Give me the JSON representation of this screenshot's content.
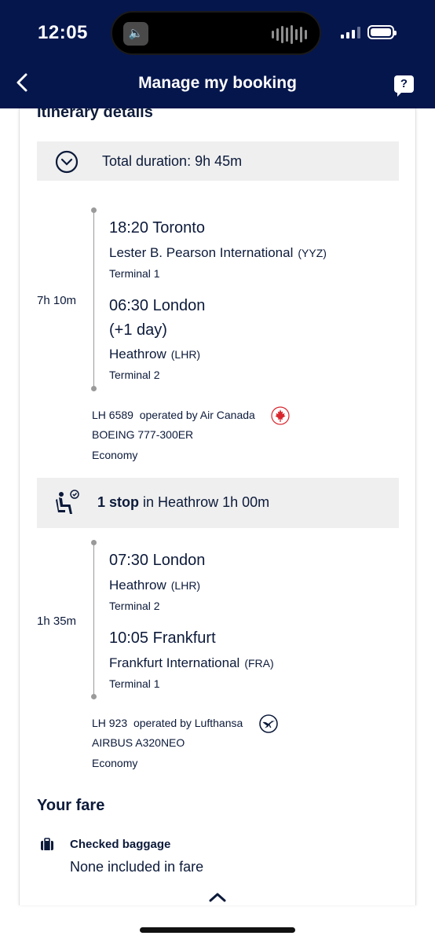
{
  "status_bar": {
    "time": "12:05"
  },
  "nav": {
    "title": "Manage my booking",
    "help_label": "?"
  },
  "itinerary": {
    "title": "Itinerary details",
    "total_duration": "Total duration: 9h 45m",
    "segments": [
      {
        "duration": "7h 10m",
        "departure": {
          "time_city": "18:20 Toronto",
          "airport": "Lester B. Pearson International",
          "code": "(YYZ)",
          "terminal": "Terminal 1"
        },
        "arrival": {
          "time_city": "06:30 London",
          "day_offset": "(+1 day)",
          "airport": "Heathrow",
          "code": "(LHR)",
          "terminal": "Terminal 2"
        },
        "flight": "LH 6589",
        "operated_by": "operated by Air Canada",
        "aircraft": "BOEING 777-300ER",
        "cabin": "Economy",
        "logo_icon": "air-canada-maple-leaf"
      },
      {
        "duration": "1h 35m",
        "departure": {
          "time_city": "07:30 London",
          "airport": "Heathrow",
          "code": "(LHR)",
          "terminal": "Terminal 2"
        },
        "arrival": {
          "time_city": "10:05 Frankfurt",
          "airport": "Frankfurt International",
          "code": "(FRA)",
          "terminal": "Terminal 1"
        },
        "flight": "LH 923",
        "operated_by": "operated by Lufthansa",
        "aircraft": "AIRBUS A320NEO",
        "cabin": "Economy",
        "logo_icon": "lufthansa-crane"
      }
    ],
    "stop": {
      "count": "1 stop",
      "detail": "in Heathrow 1h 00m"
    }
  },
  "fare": {
    "title": "Your fare",
    "items": [
      {
        "label": "Checked baggage",
        "value": "None included in fare",
        "icon": "baggage-icon"
      }
    ]
  },
  "colors": {
    "header": "#05164d",
    "text": "#0c1a3a",
    "bar": "#efefef",
    "air_canada_red": "#d8262e"
  }
}
